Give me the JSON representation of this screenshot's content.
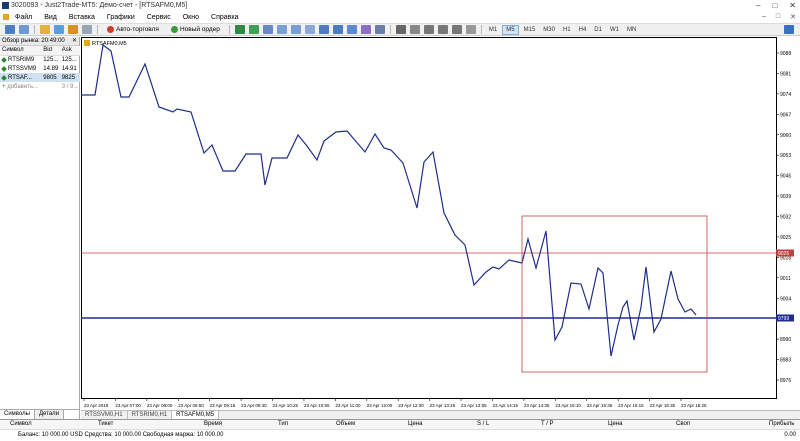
{
  "window": {
    "title": "3020093 - Just2Trade-MT5: Демо-счет - [RTSAFM0,M5]",
    "min": "–",
    "max": "□",
    "close": "✕"
  },
  "menu": [
    "Файл",
    "Вид",
    "Вставка",
    "Графики",
    "Сервис",
    "Окно",
    "Справка"
  ],
  "toolbar": {
    "autotrade": "Авто-торговля",
    "new_order": "Новый ордер",
    "timeframes": [
      "M1",
      "M5",
      "M15",
      "M30",
      "H1",
      "H4",
      "D1",
      "W1",
      "MN"
    ],
    "active_tf": "M5"
  },
  "market_watch": {
    "header": "Обзор рынка: 20:49:00",
    "columns": [
      "Символ",
      "Bid",
      "Ask"
    ],
    "rows": [
      {
        "symbol": "RTSRIM9",
        "bid": "125...",
        "ask": "125..."
      },
      {
        "symbol": "RTSSVM9",
        "bid": "14.89",
        "ask": "14.91"
      },
      {
        "symbol": "RTSAF...",
        "bid": "9805",
        "ask": "9825"
      }
    ],
    "add_label": "добавить...",
    "count": "3 / 9...",
    "tabs": [
      "Символы",
      "Детали"
    ]
  },
  "chart": {
    "label": "RTSAFM0,M5",
    "price_tags": {
      "red": "9025",
      "blue": "9799"
    }
  },
  "chart_data": {
    "type": "line",
    "y_ticks": [
      9088,
      9081,
      9074,
      9067,
      9060,
      9053,
      9046,
      9039,
      9032,
      9025,
      9018,
      9011,
      9004,
      8997,
      8990,
      8983,
      8976
    ],
    "x_ticks": [
      "23 Apr 2019",
      "23 Apr 07:00",
      "23 Apr 08:00",
      "23 Apr 08:50",
      "23 Apr 09:15",
      "23 Apr 09:40",
      "23 Apr 10:25",
      "23 Apr 10:55",
      "23 Apr 11:00",
      "23 Apr 12:00",
      "23 Apr 12:30",
      "23 Apr 13:25",
      "23 Apr 13:55",
      "23 Apr 14:15",
      "23 Apr 14:35",
      "23 Apr 15:10",
      "23 Apr 15:35",
      "23 Apr 16:15",
      "23 Apr 16:35",
      "23 Apr 16:25"
    ],
    "ylim": [
      8976,
      9088
    ],
    "line_color": "#1f2d8a",
    "hline_red": 9025,
    "hline_blue": 9799
  },
  "chart_tabs": [
    "RTSSVM0,H1",
    "RTSRIM0,H1",
    "RTSAFM0,M5"
  ],
  "terminal": {
    "columns": [
      "Символ",
      "Тикет",
      "Время",
      "Тип",
      "Объем",
      "Цена",
      "S / L",
      "T / P",
      "Цена",
      "Своп",
      "Прибыль"
    ],
    "balance": "Баланс: 10 000.00 USD  Средства: 10 000.00  Свободная маржа: 10 000.00",
    "balance_value": "0.00"
  }
}
